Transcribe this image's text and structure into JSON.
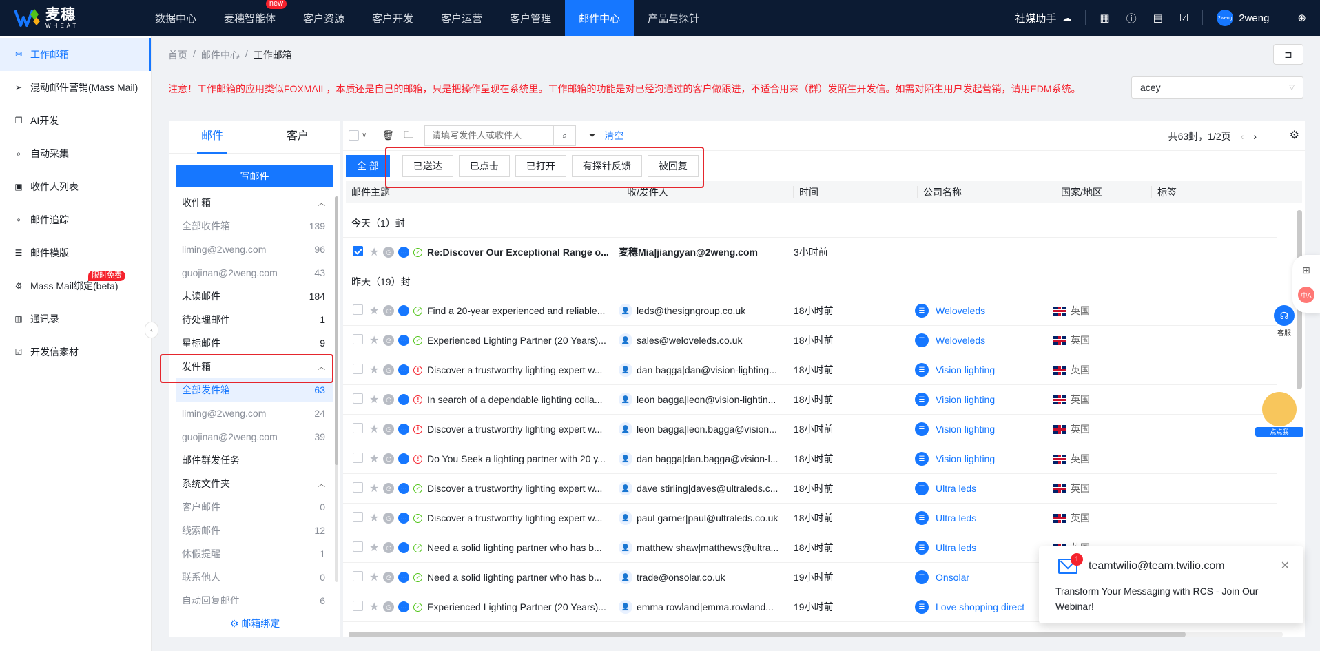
{
  "logo": {
    "cn": "麦穗",
    "en": "WHEAT"
  },
  "nav": {
    "items": [
      {
        "label": "数据中心"
      },
      {
        "label": "麦穗智能体",
        "badge": "new"
      },
      {
        "label": "客户资源"
      },
      {
        "label": "客户开发"
      },
      {
        "label": "客户运营"
      },
      {
        "label": "客户管理"
      },
      {
        "label": "邮件中心",
        "active": true
      },
      {
        "label": "产品与探针"
      }
    ],
    "social": "社媒助手",
    "user": "2weng",
    "avatar_text": "2weng"
  },
  "sidebar": {
    "items": [
      {
        "label": "工作邮箱",
        "icon": "mail-icon",
        "active": true
      },
      {
        "label": "混动邮件营销(Mass Mail)",
        "icon": "send-icon"
      },
      {
        "label": "AI开发",
        "icon": "copy-icon"
      },
      {
        "label": "自动采集",
        "icon": "search-doc-icon"
      },
      {
        "label": "收件人列表",
        "icon": "contact-card-icon"
      },
      {
        "label": "邮件追踪",
        "icon": "target-icon"
      },
      {
        "label": "邮件模版",
        "icon": "list-icon"
      },
      {
        "label": "Mass Mail绑定(beta)",
        "icon": "gear-icon",
        "badge": "限时免费"
      },
      {
        "label": "通讯录",
        "icon": "address-book-icon"
      },
      {
        "label": "开发信素材",
        "icon": "checklist-icon"
      }
    ]
  },
  "breadcrumb": {
    "home": "首页",
    "parent": "邮件中心",
    "current": "工作邮箱"
  },
  "notice": "注意！工作邮箱的应用类似FOXMAIL，本质还是自己的邮箱，只是把操作呈现在系统里。工作邮箱的功能是对已经沟通过的客户做跟进，不适合用来（群）发陌生开发信。如需对陌生用户发起营销，请用EDM系统。",
  "account_select": {
    "value": "acey"
  },
  "folder_panel": {
    "tabs": [
      "邮件",
      "客户"
    ],
    "compose": "写邮件",
    "inbox": {
      "label": "收件箱"
    },
    "inbox_items": [
      {
        "name": "全部收件箱",
        "count": "139"
      },
      {
        "name": "liming@2weng.com",
        "count": "96"
      },
      {
        "name": "guojinan@2weng.com",
        "count": "43"
      }
    ],
    "unread": {
      "name": "未读邮件",
      "count": "184"
    },
    "pending": {
      "name": "待处理邮件",
      "count": "1"
    },
    "starred": {
      "name": "星标邮件",
      "count": "9"
    },
    "outbox": {
      "label": "发件箱"
    },
    "outbox_items": [
      {
        "name": "全部发件箱",
        "count": "63"
      },
      {
        "name": "liming@2weng.com",
        "count": "24"
      },
      {
        "name": "guojinan@2weng.com",
        "count": "39"
      }
    ],
    "mass_task": "邮件群发任务",
    "system": {
      "label": "系统文件夹"
    },
    "system_items": [
      {
        "name": "客户邮件",
        "count": "0"
      },
      {
        "name": "线索邮件",
        "count": "12"
      },
      {
        "name": "休假提醒",
        "count": "1"
      },
      {
        "name": "联系他人",
        "count": "0"
      },
      {
        "name": "自动回复邮件",
        "count": "6"
      }
    ],
    "bind": "邮箱绑定"
  },
  "toolbar": {
    "search_placeholder": "请填写发件人或收件人",
    "clear": "清空",
    "pager_text": "共63封，1/2页"
  },
  "filters": [
    "全 部",
    "已送达",
    "已点击",
    "已打开",
    "有探针反馈",
    "被回复"
  ],
  "columns": [
    "邮件主题",
    "收/发件人",
    "时间",
    "公司名称",
    "国家/地区",
    "标签"
  ],
  "groups": {
    "today": "今天（1）封",
    "yesterday": "昨天（19）封"
  },
  "today_rows": [
    {
      "subject": "Re:Discover Our Exceptional Range o...",
      "from": "麦穗Mia|jiangyan@2weng.com",
      "time": "3小时前",
      "company": "",
      "country": "",
      "status": "ok"
    }
  ],
  "rows": [
    {
      "subject": "Find a 20-year experienced and reliable...",
      "from": "leds@thesigngroup.co.uk",
      "time": "18小时前",
      "company": "Weloveleds",
      "country": "英国",
      "status": "ok"
    },
    {
      "subject": "Experienced Lighting Partner (20 Years)...",
      "from": "sales@weloveleds.co.uk",
      "time": "18小时前",
      "company": "Weloveleds",
      "country": "英国",
      "status": "ok"
    },
    {
      "subject": "Discover a trustworthy lighting expert w...",
      "from": "dan bagga|dan@vision-lighting...",
      "time": "18小时前",
      "company": "Vision lighting",
      "country": "英国",
      "status": "err"
    },
    {
      "subject": "In search of a dependable lighting colla...",
      "from": "leon bagga|leon@vision-lightin...",
      "time": "18小时前",
      "company": "Vision lighting",
      "country": "英国",
      "status": "err"
    },
    {
      "subject": "Discover a trustworthy lighting expert w...",
      "from": "leon bagga|leon.bagga@vision...",
      "time": "18小时前",
      "company": "Vision lighting",
      "country": "英国",
      "status": "err"
    },
    {
      "subject": "Do You Seek a lighting partner with 20 y...",
      "from": "dan bagga|dan.bagga@vision-l...",
      "time": "18小时前",
      "company": "Vision lighting",
      "country": "英国",
      "status": "err"
    },
    {
      "subject": "Discover a trustworthy lighting expert w...",
      "from": "dave stirling|daves@ultraleds.c...",
      "time": "18小时前",
      "company": "Ultra leds",
      "country": "英国",
      "status": "ok"
    },
    {
      "subject": "Discover a trustworthy lighting expert w...",
      "from": "paul garner|paul@ultraleds.co.uk",
      "time": "18小时前",
      "company": "Ultra leds",
      "country": "英国",
      "status": "ok"
    },
    {
      "subject": "Need a solid lighting partner who has b...",
      "from": "matthew shaw|matthews@ultra...",
      "time": "18小时前",
      "company": "Ultra leds",
      "country": "英国",
      "status": "ok"
    },
    {
      "subject": "Need a solid lighting partner who has b...",
      "from": "trade@onsolar.co.uk",
      "time": "19小时前",
      "company": "Onsolar",
      "country": "",
      "status": "ok"
    },
    {
      "subject": "Experienced Lighting Partner (20 Years)...",
      "from": "emma rowland|emma.rowland...",
      "time": "19小时前",
      "company": "Love shopping direct",
      "country": "",
      "status": "ok"
    }
  ],
  "float": {
    "service": "客服",
    "mascot_tag": "点点我",
    "cn_badge": "中A"
  },
  "toast": {
    "count": "1",
    "from": "teamtwilio@team.twilio.com",
    "message": "Transform Your Messaging with RCS - Join Our Webinar!"
  },
  "colors": {
    "primary": "#1677ff",
    "topbar": "#0c1b33",
    "danger": "#f5222d",
    "success": "#52c41a"
  }
}
